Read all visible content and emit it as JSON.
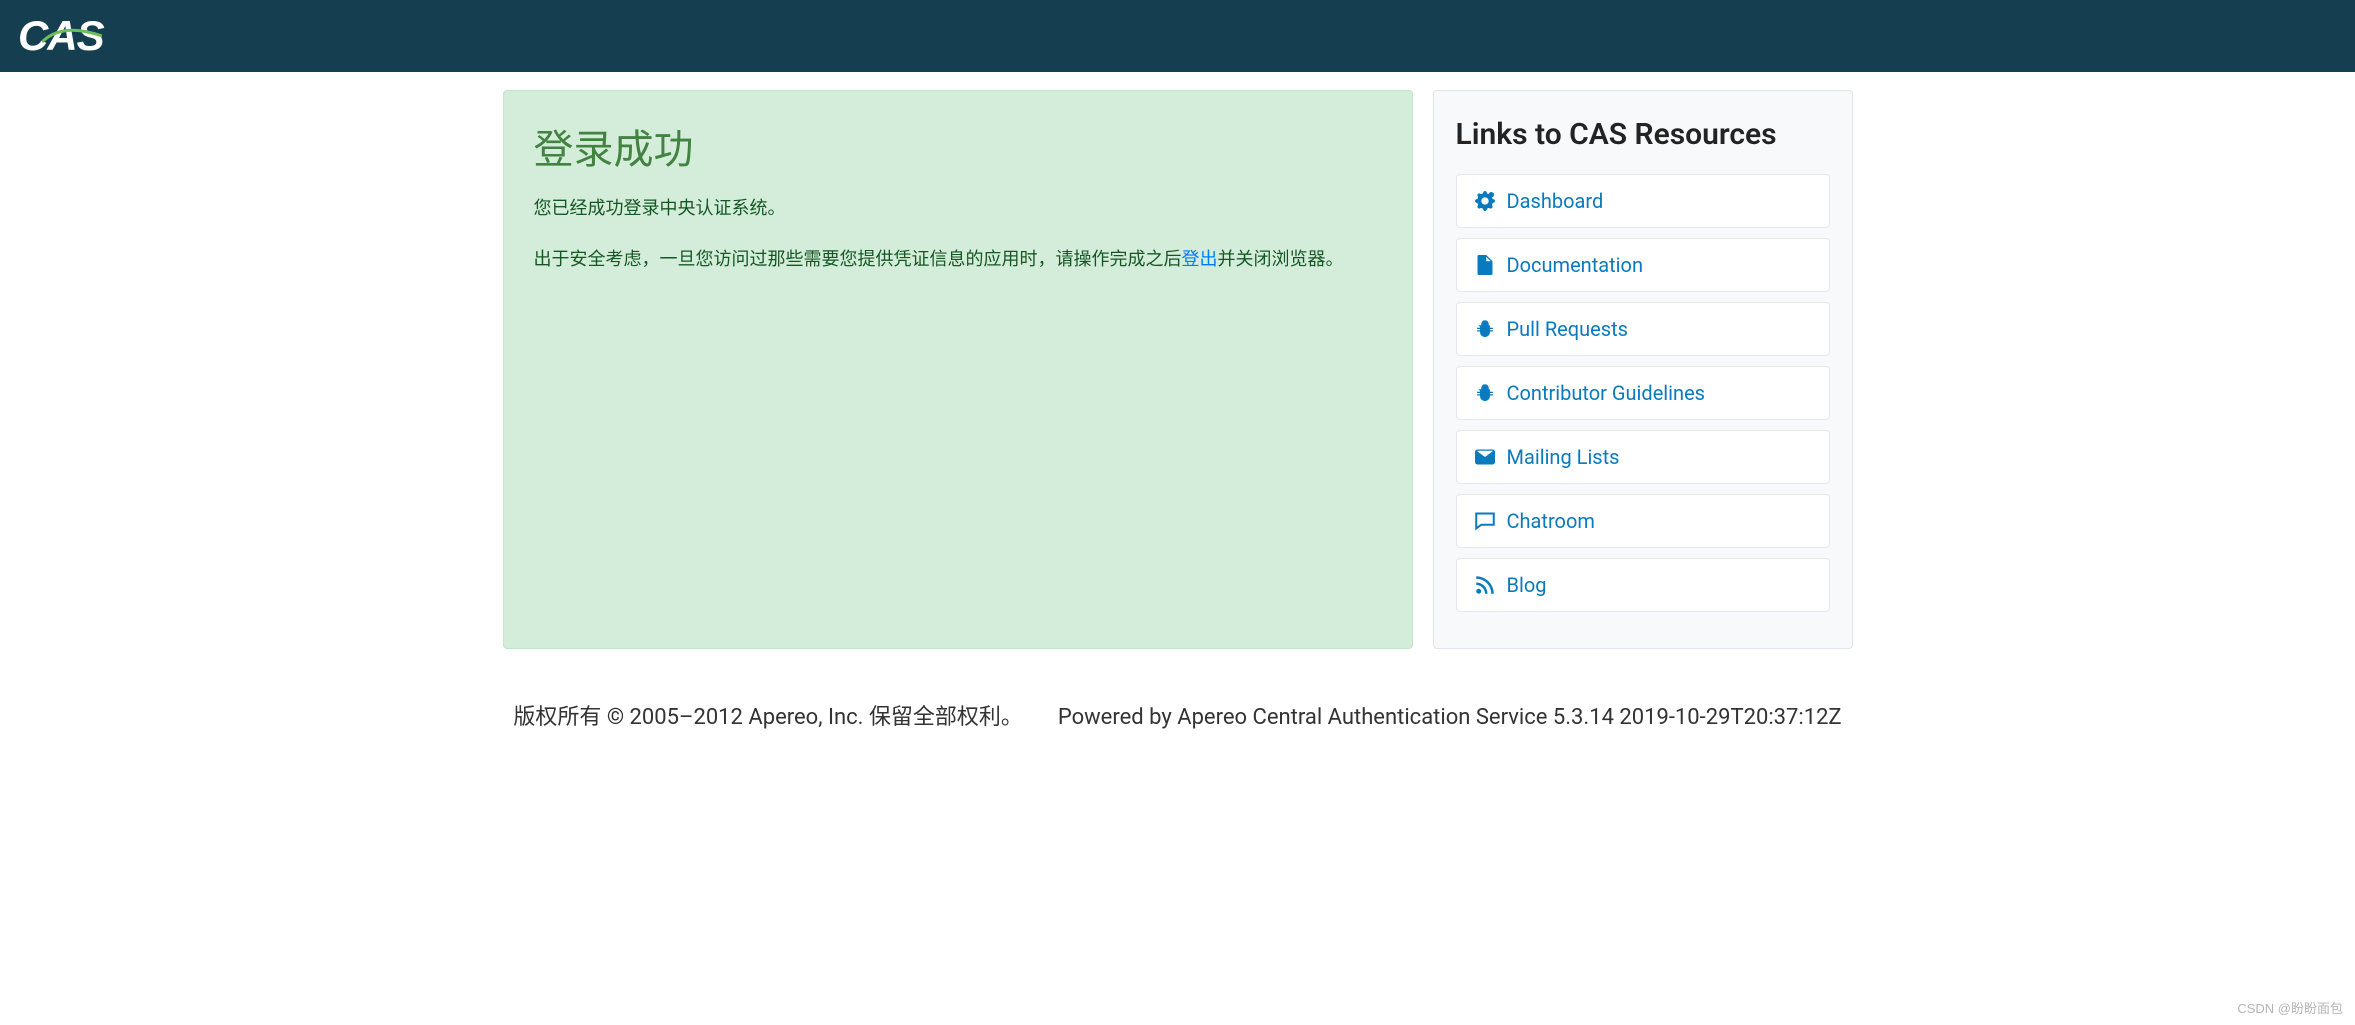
{
  "header": {
    "logo_text": "CAS"
  },
  "main": {
    "title": "登录成功",
    "line1": "您已经成功登录中央认证系统。",
    "line2_pre": "出于安全考虑，一旦您访问过那些需要您提供凭证信息的应用时，请操作完成之后",
    "logout_link": "登出",
    "line2_post": "并关闭浏览器。"
  },
  "sidebar": {
    "title": "Links to CAS Resources",
    "items": [
      {
        "icon": "dashboard-icon",
        "label": "Dashboard"
      },
      {
        "icon": "file-icon",
        "label": "Documentation"
      },
      {
        "icon": "bug-icon",
        "label": "Pull Requests"
      },
      {
        "icon": "bug-icon",
        "label": "Contributor Guidelines"
      },
      {
        "icon": "envelope-icon",
        "label": "Mailing Lists"
      },
      {
        "icon": "chat-icon",
        "label": "Chatroom"
      },
      {
        "icon": "rss-icon",
        "label": "Blog"
      }
    ]
  },
  "footer": {
    "copyright": "版权所有 © 2005–2012 Apereo, Inc. 保留全部权利。",
    "powered": "Powered by Apereo Central Authentication Service 5.3.14 2019-10-29T20:37:12Z"
  },
  "watermark": "CSDN @盼盼面包"
}
